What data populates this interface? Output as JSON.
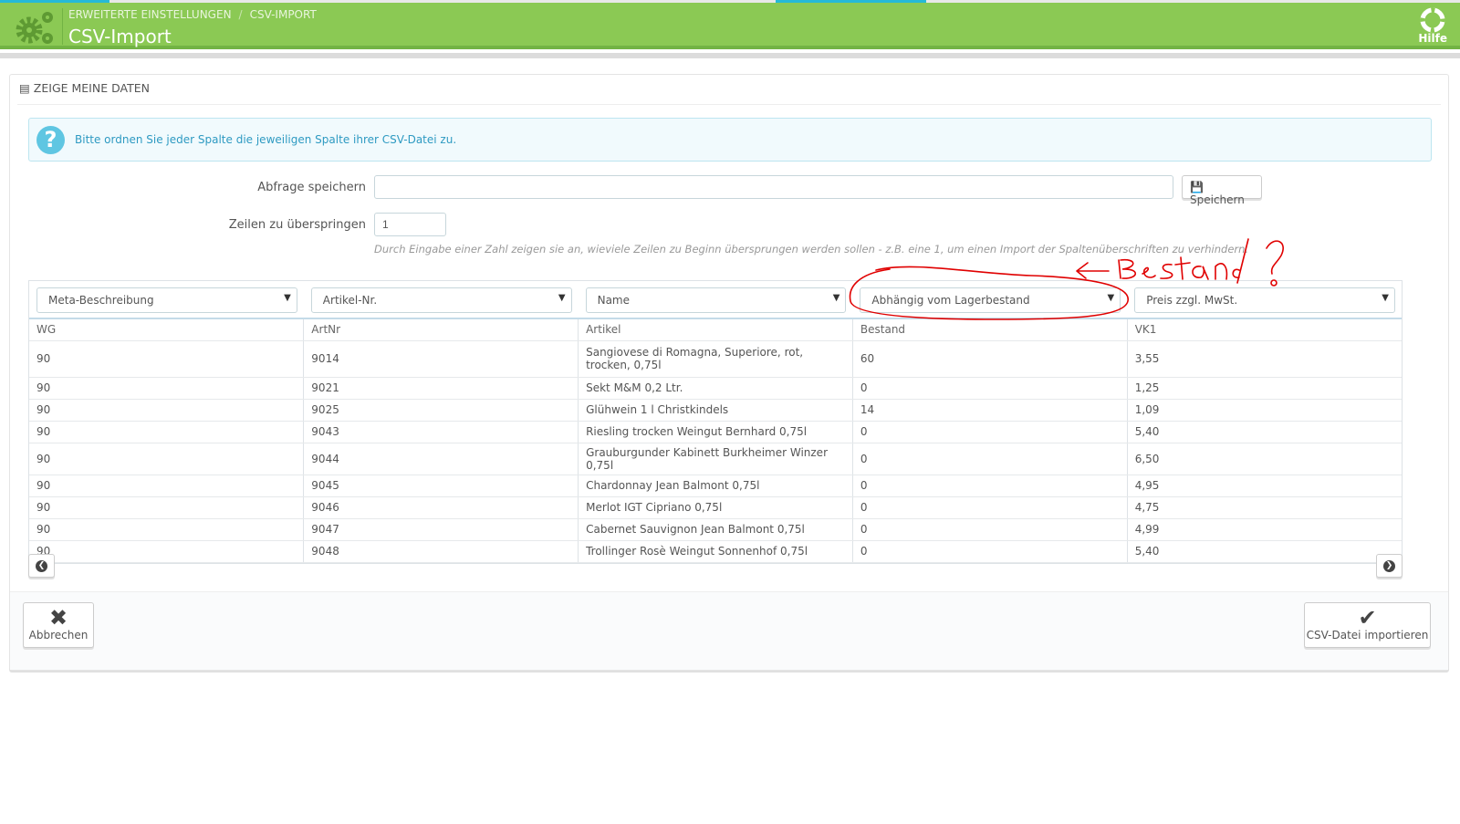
{
  "header": {
    "breadcrumb": [
      "ERWEITERTE EINSTELLUNGEN",
      "CSV-IMPORT"
    ],
    "breadcrumb_sep": "/",
    "title": "CSV-Import",
    "help_label": "Hilfe",
    "color": "#8bc954"
  },
  "panel": {
    "heading": "Zeige meine Daten",
    "icon": "list-alt-icon"
  },
  "alert": {
    "text": "Bitte ordnen Sie jeder Spalte die jeweiligen Spalte ihrer CSV-Datei zu.",
    "icon": "question-icon"
  },
  "form": {
    "save_query_label": "Abfrage speichern",
    "save_query_value": "",
    "save_button": "Speichern",
    "skip_rows_label": "Zeilen zu überspringen",
    "skip_rows_value": "1",
    "hint": "Durch Eingabe einer Zahl zeigen sie an, wieviele Zeilen zu Beginn übersprungen werden sollen - z.B. eine 1, um einen Import der Spaltenüberschriften zu verhindern."
  },
  "mapping": [
    "Meta-Beschreibung",
    "Artikel-Nr.",
    "Name",
    "Abhängig vom Lagerbestand",
    "Preis zzgl. MwSt."
  ],
  "table": {
    "headers": [
      "WG",
      "ArtNr",
      "Artikel",
      "Bestand",
      "VK1"
    ],
    "rows": [
      [
        "90",
        "9014",
        "Sangiovese di Romagna, Superiore, rot, trocken, 0,75l",
        "60",
        "3,55"
      ],
      [
        "90",
        "9021",
        "Sekt M&M 0,2 Ltr.",
        "0",
        "1,25"
      ],
      [
        "90",
        "9025",
        "Glühwein 1 l Christkindels",
        "14",
        "1,09"
      ],
      [
        "90",
        "9043",
        "Riesling trocken Weingut Bernhard 0,75l",
        "0",
        "5,40"
      ],
      [
        "90",
        "9044",
        "Grauburgunder Kabinett Burkheimer Winzer 0,75l",
        "0",
        "6,50"
      ],
      [
        "90",
        "9045",
        "Chardonnay Jean Balmont 0,75l",
        "0",
        "4,95"
      ],
      [
        "90",
        "9046",
        "Merlot IGT Cipriano 0,75l",
        "0",
        "4,75"
      ],
      [
        "90",
        "9047",
        "Cabernet Sauvignon Jean Balmont 0,75l",
        "0",
        "4,99"
      ],
      [
        "90",
        "9048",
        "Trollinger Rosè Weingut Sonnenhof 0,75l",
        "0",
        "5,40"
      ]
    ]
  },
  "footer": {
    "cancel": "Abbrechen",
    "import": "CSV-Datei importieren"
  },
  "annotation": {
    "text": "Bestand ?",
    "color": "#e00000"
  }
}
